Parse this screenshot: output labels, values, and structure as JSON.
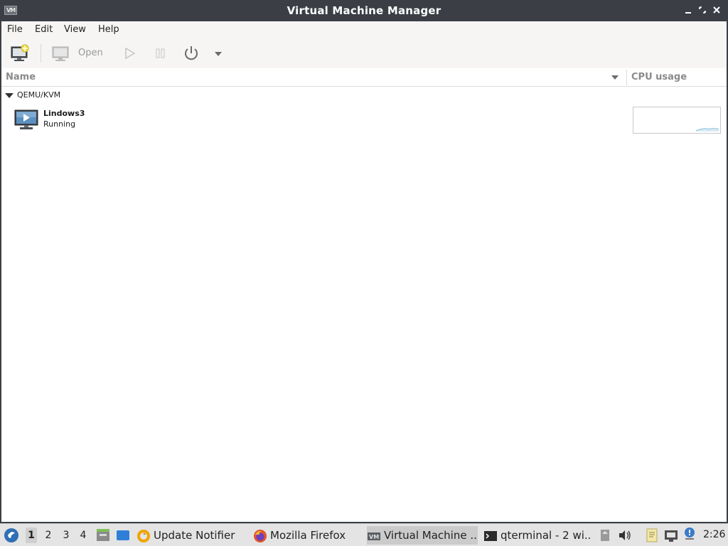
{
  "window": {
    "title": "Virtual Machine Manager",
    "title_icon_text": "VM"
  },
  "menubar": {
    "items": [
      "File",
      "Edit",
      "View",
      "Help"
    ]
  },
  "toolbar": {
    "open_label": "Open"
  },
  "list": {
    "column_name": "Name",
    "column_cpu": "CPU usage",
    "group": "QEMU/KVM",
    "vms": [
      {
        "name": "Lindows3",
        "status": "Running"
      }
    ]
  },
  "taskbar": {
    "desktops": [
      "1",
      "2",
      "3",
      "4"
    ],
    "active_desktop": "1",
    "tasks": [
      {
        "label": "Update Notifier",
        "icon": "update-notifier-icon"
      },
      {
        "label": "Mozilla Firefox",
        "icon": "firefox-icon"
      },
      {
        "label": "Virtual Machine ...",
        "icon": "virt-manager-icon"
      },
      {
        "label": "qterminal - 2 wi...",
        "icon": "terminal-icon"
      }
    ],
    "clock": "2:26"
  },
  "colors": {
    "titlebar": "#3b3f45",
    "window_bg": "#ffffff",
    "toolbar_bg": "#f6f5f4",
    "taskbar_bg": "#e4e4e4",
    "cpu_line": "#5ba3c9"
  }
}
